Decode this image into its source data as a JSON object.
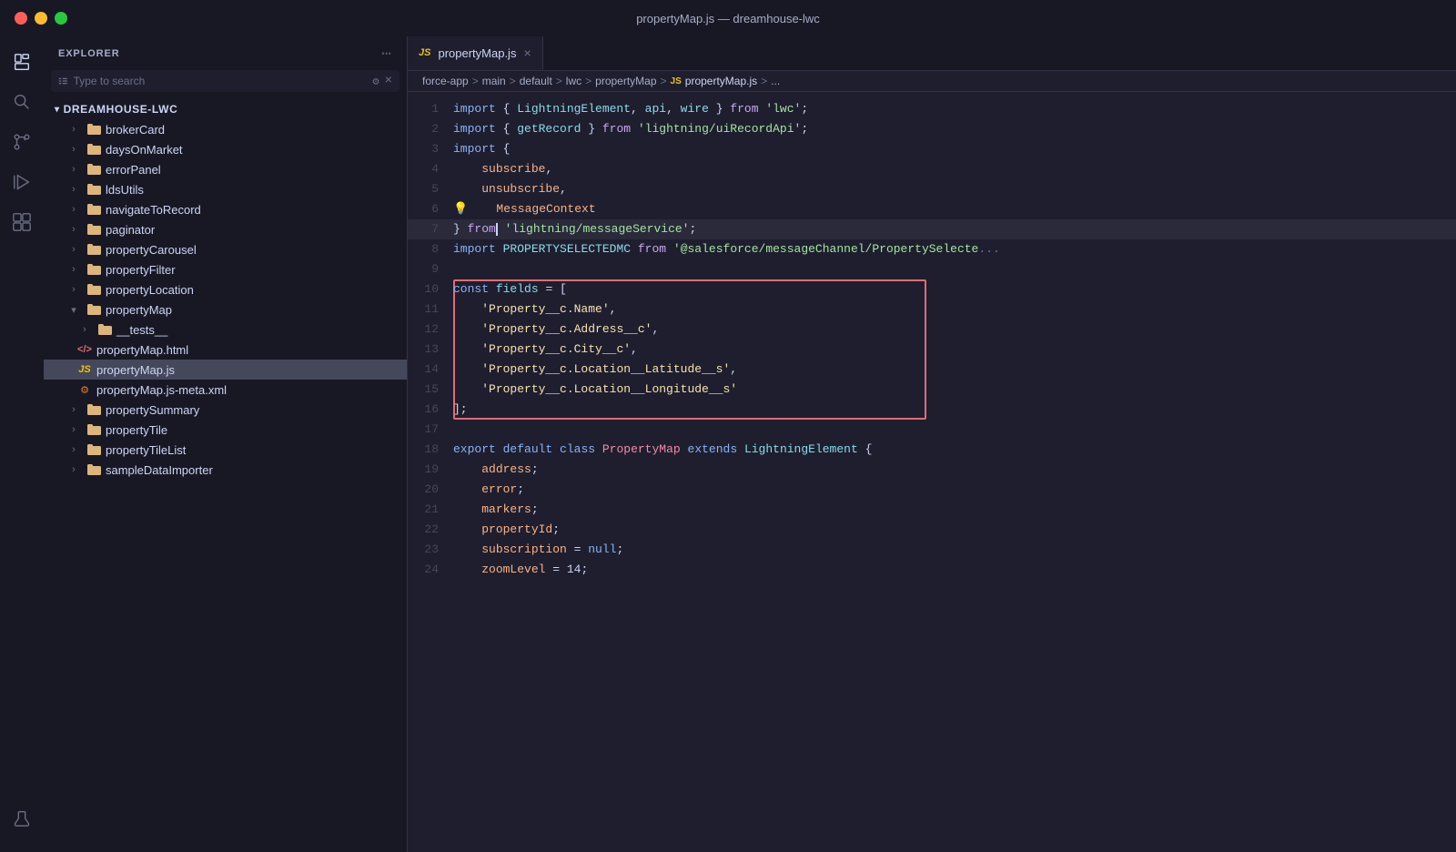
{
  "titlebar": {
    "title": "propertyMap.js — dreamhouse-lwc"
  },
  "activitybar": {
    "icons": [
      {
        "name": "explorer-icon",
        "label": "Explorer",
        "active": true
      },
      {
        "name": "search-icon",
        "label": "Search",
        "active": false
      },
      {
        "name": "source-control-icon",
        "label": "Source Control",
        "active": false
      },
      {
        "name": "run-icon",
        "label": "Run",
        "active": false
      },
      {
        "name": "extensions-icon",
        "label": "Extensions",
        "active": false
      },
      {
        "name": "flask-icon",
        "label": "Testing",
        "active": false
      }
    ]
  },
  "sidebar": {
    "title": "EXPLORER",
    "section": "DREAMHOUSE-LWC",
    "search_placeholder": "Type to search",
    "items": [
      {
        "label": "brokerCard",
        "type": "folder",
        "depth": 1,
        "expanded": false
      },
      {
        "label": "daysOnMarket",
        "type": "folder",
        "depth": 1,
        "expanded": false
      },
      {
        "label": "errorPanel",
        "type": "folder",
        "depth": 1,
        "expanded": false
      },
      {
        "label": "ldsUtils",
        "type": "folder",
        "depth": 1,
        "expanded": false
      },
      {
        "label": "navigateToRecord",
        "type": "folder",
        "depth": 1,
        "expanded": false
      },
      {
        "label": "paginator",
        "type": "folder",
        "depth": 1,
        "expanded": false
      },
      {
        "label": "propertyCarousel",
        "type": "folder",
        "depth": 1,
        "expanded": false
      },
      {
        "label": "propertyFilter",
        "type": "folder",
        "depth": 1,
        "expanded": false
      },
      {
        "label": "propertyLocation",
        "type": "folder",
        "depth": 1,
        "expanded": false
      },
      {
        "label": "propertyMap",
        "type": "folder",
        "depth": 1,
        "expanded": true
      },
      {
        "label": "__tests__",
        "type": "folder",
        "depth": 2,
        "expanded": false
      },
      {
        "label": "propertyMap.html",
        "type": "html",
        "depth": 2
      },
      {
        "label": "propertyMap.js",
        "type": "js",
        "depth": 2,
        "active": true
      },
      {
        "label": "propertyMap.js-meta.xml",
        "type": "xml",
        "depth": 2
      },
      {
        "label": "propertySummary",
        "type": "folder",
        "depth": 1,
        "expanded": false
      },
      {
        "label": "propertyTile",
        "type": "folder",
        "depth": 1,
        "expanded": false
      },
      {
        "label": "propertyTileList",
        "type": "folder",
        "depth": 1,
        "expanded": false
      },
      {
        "label": "sampleDataImporter",
        "type": "folder",
        "depth": 1,
        "expanded": false
      }
    ]
  },
  "editor": {
    "tab_label": "propertyMap.js",
    "tab_icon": "JS",
    "breadcrumb": [
      "force-app",
      ">",
      "main",
      ">",
      "default",
      ">",
      "lwc",
      ">",
      "propertyMap",
      ">",
      "JS propertyMap.js",
      ">",
      "..."
    ],
    "lines": [
      {
        "num": 1,
        "tokens": [
          {
            "t": "kw",
            "v": "import"
          },
          {
            "t": "punct",
            "v": " { "
          },
          {
            "t": "fn",
            "v": "LightningElement"
          },
          {
            "t": "punct",
            "v": ", "
          },
          {
            "t": "fn",
            "v": "api"
          },
          {
            "t": "punct",
            "v": ", "
          },
          {
            "t": "fn",
            "v": "wire"
          },
          {
            "t": "punct",
            "v": " } "
          },
          {
            "t": "kw2",
            "v": "from"
          },
          {
            "t": "punct",
            "v": " "
          },
          {
            "t": "str",
            "v": "'lwc'"
          },
          {
            "t": "punct",
            "v": ";"
          }
        ]
      },
      {
        "num": 2,
        "tokens": [
          {
            "t": "kw",
            "v": "import"
          },
          {
            "t": "punct",
            "v": " { "
          },
          {
            "t": "fn",
            "v": "getRecord"
          },
          {
            "t": "punct",
            "v": " } "
          },
          {
            "t": "kw2",
            "v": "from"
          },
          {
            "t": "punct",
            "v": " "
          },
          {
            "t": "str",
            "v": "'lightning/uiRecordApi'"
          },
          {
            "t": "punct",
            "v": ";"
          }
        ]
      },
      {
        "num": 3,
        "tokens": [
          {
            "t": "kw",
            "v": "import"
          },
          {
            "t": "punct",
            "v": " {"
          }
        ]
      },
      {
        "num": 4,
        "tokens": [
          {
            "t": "punct",
            "v": "    "
          },
          {
            "t": "prop",
            "v": "subscribe"
          },
          {
            "t": "punct",
            "v": ","
          }
        ]
      },
      {
        "num": 5,
        "tokens": [
          {
            "t": "punct",
            "v": "    "
          },
          {
            "t": "prop",
            "v": "unsubscribe"
          },
          {
            "t": "punct",
            "v": ","
          }
        ]
      },
      {
        "num": 6,
        "tokens": [
          {
            "t": "bulb",
            "v": "💡"
          },
          {
            "t": "punct",
            "v": "    "
          },
          {
            "t": "prop",
            "v": "MessageContext"
          }
        ]
      },
      {
        "num": 7,
        "tokens": [
          {
            "t": "punct",
            "v": "} "
          },
          {
            "t": "kw2",
            "v": "from"
          },
          {
            "t": "punct",
            "v": "❙ "
          },
          {
            "t": "str",
            "v": "'lightning/messageService'"
          },
          {
            "t": "punct",
            "v": ";"
          }
        ],
        "cursor": true
      },
      {
        "num": 8,
        "tokens": [
          {
            "t": "kw",
            "v": "import"
          },
          {
            "t": "punct",
            "v": " "
          },
          {
            "t": "fn",
            "v": "PROPERTYSELECTEDMC"
          },
          {
            "t": "punct",
            "v": " "
          },
          {
            "t": "kw2",
            "v": "from"
          },
          {
            "t": "punct",
            "v": " "
          },
          {
            "t": "str",
            "v": "'@salesforce/messageChannel/PropertySelecte"
          },
          {
            "t": "comment",
            "v": "..."
          }
        ]
      },
      {
        "num": 9,
        "tokens": []
      },
      {
        "num": 10,
        "tokens": [
          {
            "t": "kw",
            "v": "const"
          },
          {
            "t": "punct",
            "v": " "
          },
          {
            "t": "fn",
            "v": "fields"
          },
          {
            "t": "punct",
            "v": " = ["
          }
        ],
        "highlight_start": true
      },
      {
        "num": 11,
        "tokens": [
          {
            "t": "punct",
            "v": "    "
          },
          {
            "t": "str2",
            "v": "'Property__c.Name'"
          },
          {
            "t": "punct",
            "v": ","
          }
        ]
      },
      {
        "num": 12,
        "tokens": [
          {
            "t": "punct",
            "v": "    "
          },
          {
            "t": "str2",
            "v": "'Property__c.Address__c'"
          },
          {
            "t": "punct",
            "v": ","
          }
        ]
      },
      {
        "num": 13,
        "tokens": [
          {
            "t": "punct",
            "v": "    "
          },
          {
            "t": "str2",
            "v": "'Property__c.City__c'"
          },
          {
            "t": "punct",
            "v": ","
          }
        ]
      },
      {
        "num": 14,
        "tokens": [
          {
            "t": "punct",
            "v": "    "
          },
          {
            "t": "str2",
            "v": "'Property__c.Location__Latitude__s'"
          },
          {
            "t": "punct",
            "v": ","
          }
        ]
      },
      {
        "num": 15,
        "tokens": [
          {
            "t": "punct",
            "v": "    "
          },
          {
            "t": "str2",
            "v": "'Property__c.Location__Longitude__s'"
          }
        ]
      },
      {
        "num": 16,
        "tokens": [
          {
            "t": "punct",
            "v": "];"
          }
        ],
        "highlight_end": true
      },
      {
        "num": 17,
        "tokens": []
      },
      {
        "num": 18,
        "tokens": [
          {
            "t": "kw",
            "v": "export"
          },
          {
            "t": "punct",
            "v": " "
          },
          {
            "t": "kw",
            "v": "default"
          },
          {
            "t": "punct",
            "v": " "
          },
          {
            "t": "kw",
            "v": "class"
          },
          {
            "t": "punct",
            "v": " "
          },
          {
            "t": "cls",
            "v": "PropertyMap"
          },
          {
            "t": "punct",
            "v": " "
          },
          {
            "t": "kw",
            "v": "extends"
          },
          {
            "t": "punct",
            "v": " "
          },
          {
            "t": "fn",
            "v": "LightningElement"
          },
          {
            "t": "punct",
            "v": " {"
          }
        ]
      },
      {
        "num": 19,
        "tokens": [
          {
            "t": "punct",
            "v": "    "
          },
          {
            "t": "prop",
            "v": "address"
          },
          {
            "t": "punct",
            "v": ";"
          }
        ]
      },
      {
        "num": 20,
        "tokens": [
          {
            "t": "punct",
            "v": "    "
          },
          {
            "t": "prop",
            "v": "error"
          },
          {
            "t": "punct",
            "v": ";"
          }
        ]
      },
      {
        "num": 21,
        "tokens": [
          {
            "t": "punct",
            "v": "    "
          },
          {
            "t": "prop",
            "v": "markers"
          },
          {
            "t": "punct",
            "v": ";"
          }
        ]
      },
      {
        "num": 22,
        "tokens": [
          {
            "t": "punct",
            "v": "    "
          },
          {
            "t": "prop",
            "v": "propertyId"
          },
          {
            "t": "punct",
            "v": ";"
          }
        ]
      },
      {
        "num": 23,
        "tokens": [
          {
            "t": "punct",
            "v": "    "
          },
          {
            "t": "prop",
            "v": "subscription"
          },
          {
            "t": "punct",
            "v": " = "
          },
          {
            "t": "kw",
            "v": "null"
          },
          {
            "t": "punct",
            "v": ";"
          }
        ]
      },
      {
        "num": 24,
        "tokens": [
          {
            "t": "punct",
            "v": "    "
          },
          {
            "t": "prop",
            "v": "zoomLevel"
          },
          {
            "t": "punct",
            "v": " = 14;"
          }
        ]
      }
    ]
  }
}
